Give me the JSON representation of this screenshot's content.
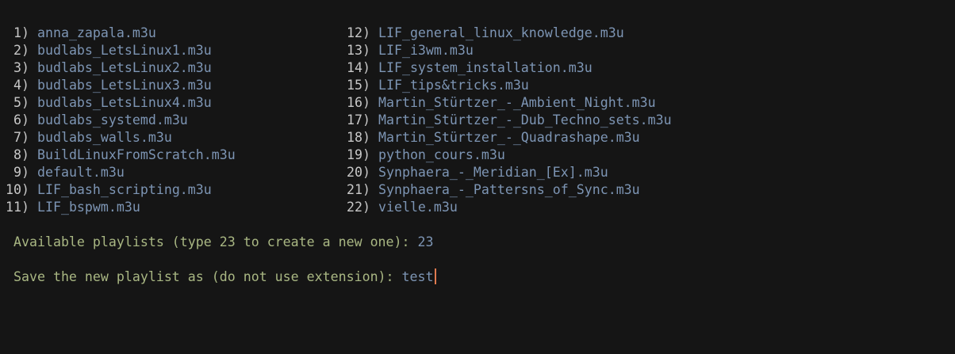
{
  "playlists_left": [
    {
      "num": " 1)",
      "name": "anna_zapala.m3u"
    },
    {
      "num": " 2)",
      "name": "budlabs_LetsLinux1.m3u"
    },
    {
      "num": " 3)",
      "name": "budlabs_LetsLinux2.m3u"
    },
    {
      "num": " 4)",
      "name": "budlabs_LetsLinux3.m3u"
    },
    {
      "num": " 5)",
      "name": "budlabs_LetsLinux4.m3u"
    },
    {
      "num": " 6)",
      "name": "budlabs_systemd.m3u"
    },
    {
      "num": " 7)",
      "name": "budlabs_walls.m3u"
    },
    {
      "num": " 8)",
      "name": "BuildLinuxFromScratch.m3u"
    },
    {
      "num": " 9)",
      "name": "default.m3u"
    },
    {
      "num": "10)",
      "name": "LIF_bash_scripting.m3u"
    },
    {
      "num": "11)",
      "name": "LIF_bspwm.m3u"
    }
  ],
  "playlists_right": [
    {
      "num": "12)",
      "name": "LIF_general_linux_knowledge.m3u"
    },
    {
      "num": "13)",
      "name": "LIF_i3wm.m3u"
    },
    {
      "num": "14)",
      "name": "LIF_system_installation.m3u"
    },
    {
      "num": "15)",
      "name": "LIF_tips&tricks.m3u"
    },
    {
      "num": "16)",
      "name": "Martin_Stürtzer_-_Ambient_Night.m3u"
    },
    {
      "num": "17)",
      "name": "Martin_Stürtzer_-_Dub_Techno_sets.m3u"
    },
    {
      "num": "18)",
      "name": "Martin_Stürtzer_-_Quadrashape.m3u"
    },
    {
      "num": "19)",
      "name": "python_cours.m3u"
    },
    {
      "num": "20)",
      "name": "Synphaera_-_Meridian_[Ex].m3u"
    },
    {
      "num": "21)",
      "name": "Synphaera_-_Pattersns_of_Sync.m3u"
    },
    {
      "num": "22)",
      "name": "vielle.m3u"
    }
  ],
  "prompt1": {
    "text": "Available playlists (type 23 to create a new one): ",
    "answer": "23"
  },
  "prompt2": {
    "text": "Save the new playlist as (do not use extension): ",
    "answer": "test"
  },
  "colors": {
    "background": "#151515",
    "filename": "#7d95b4",
    "prompt": "#a9b783",
    "number": "#c8c8c8",
    "cursor": "#e07a4f"
  }
}
